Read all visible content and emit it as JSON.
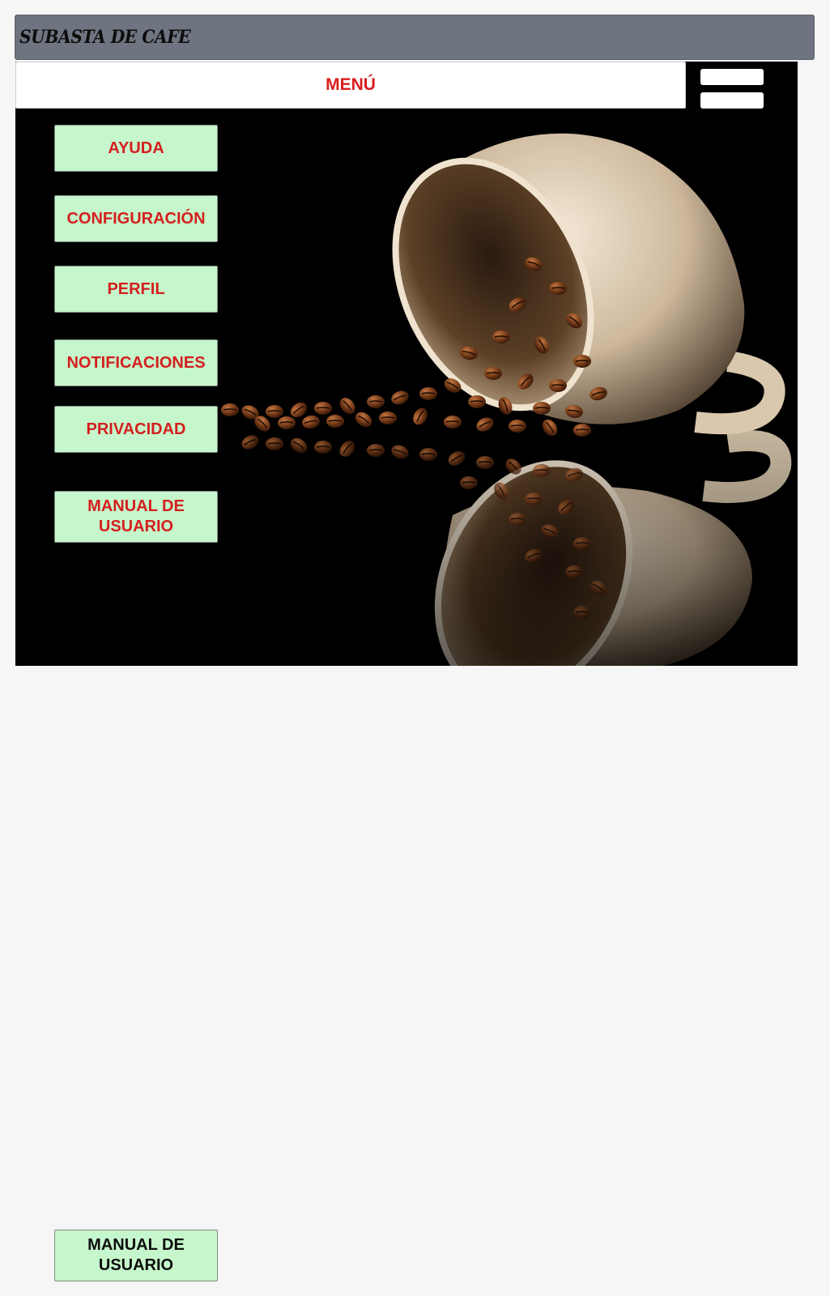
{
  "app": {
    "title": "SUBASTA DE CAFE"
  },
  "menu": {
    "label": "MENÚ",
    "hamburger_icon": "hamburger-menu-icon"
  },
  "sidebar": {
    "items": [
      {
        "label": "AYUDA"
      },
      {
        "label": "CONFIGURACIÓN"
      },
      {
        "label": "PERFIL"
      },
      {
        "label": "NOTIFICACIONES"
      },
      {
        "label": "PRIVACIDAD"
      },
      {
        "label": "MANUAL DE USUARIO"
      }
    ]
  },
  "footer": {
    "manual_button": "MANUAL DE USUARIO"
  },
  "colors": {
    "header_bg": "#6e7480",
    "menu_text": "#d81e1e",
    "button_bg": "#c6f6cb",
    "page_bg": "#f6f6f6",
    "stage_bg": "#000000"
  }
}
